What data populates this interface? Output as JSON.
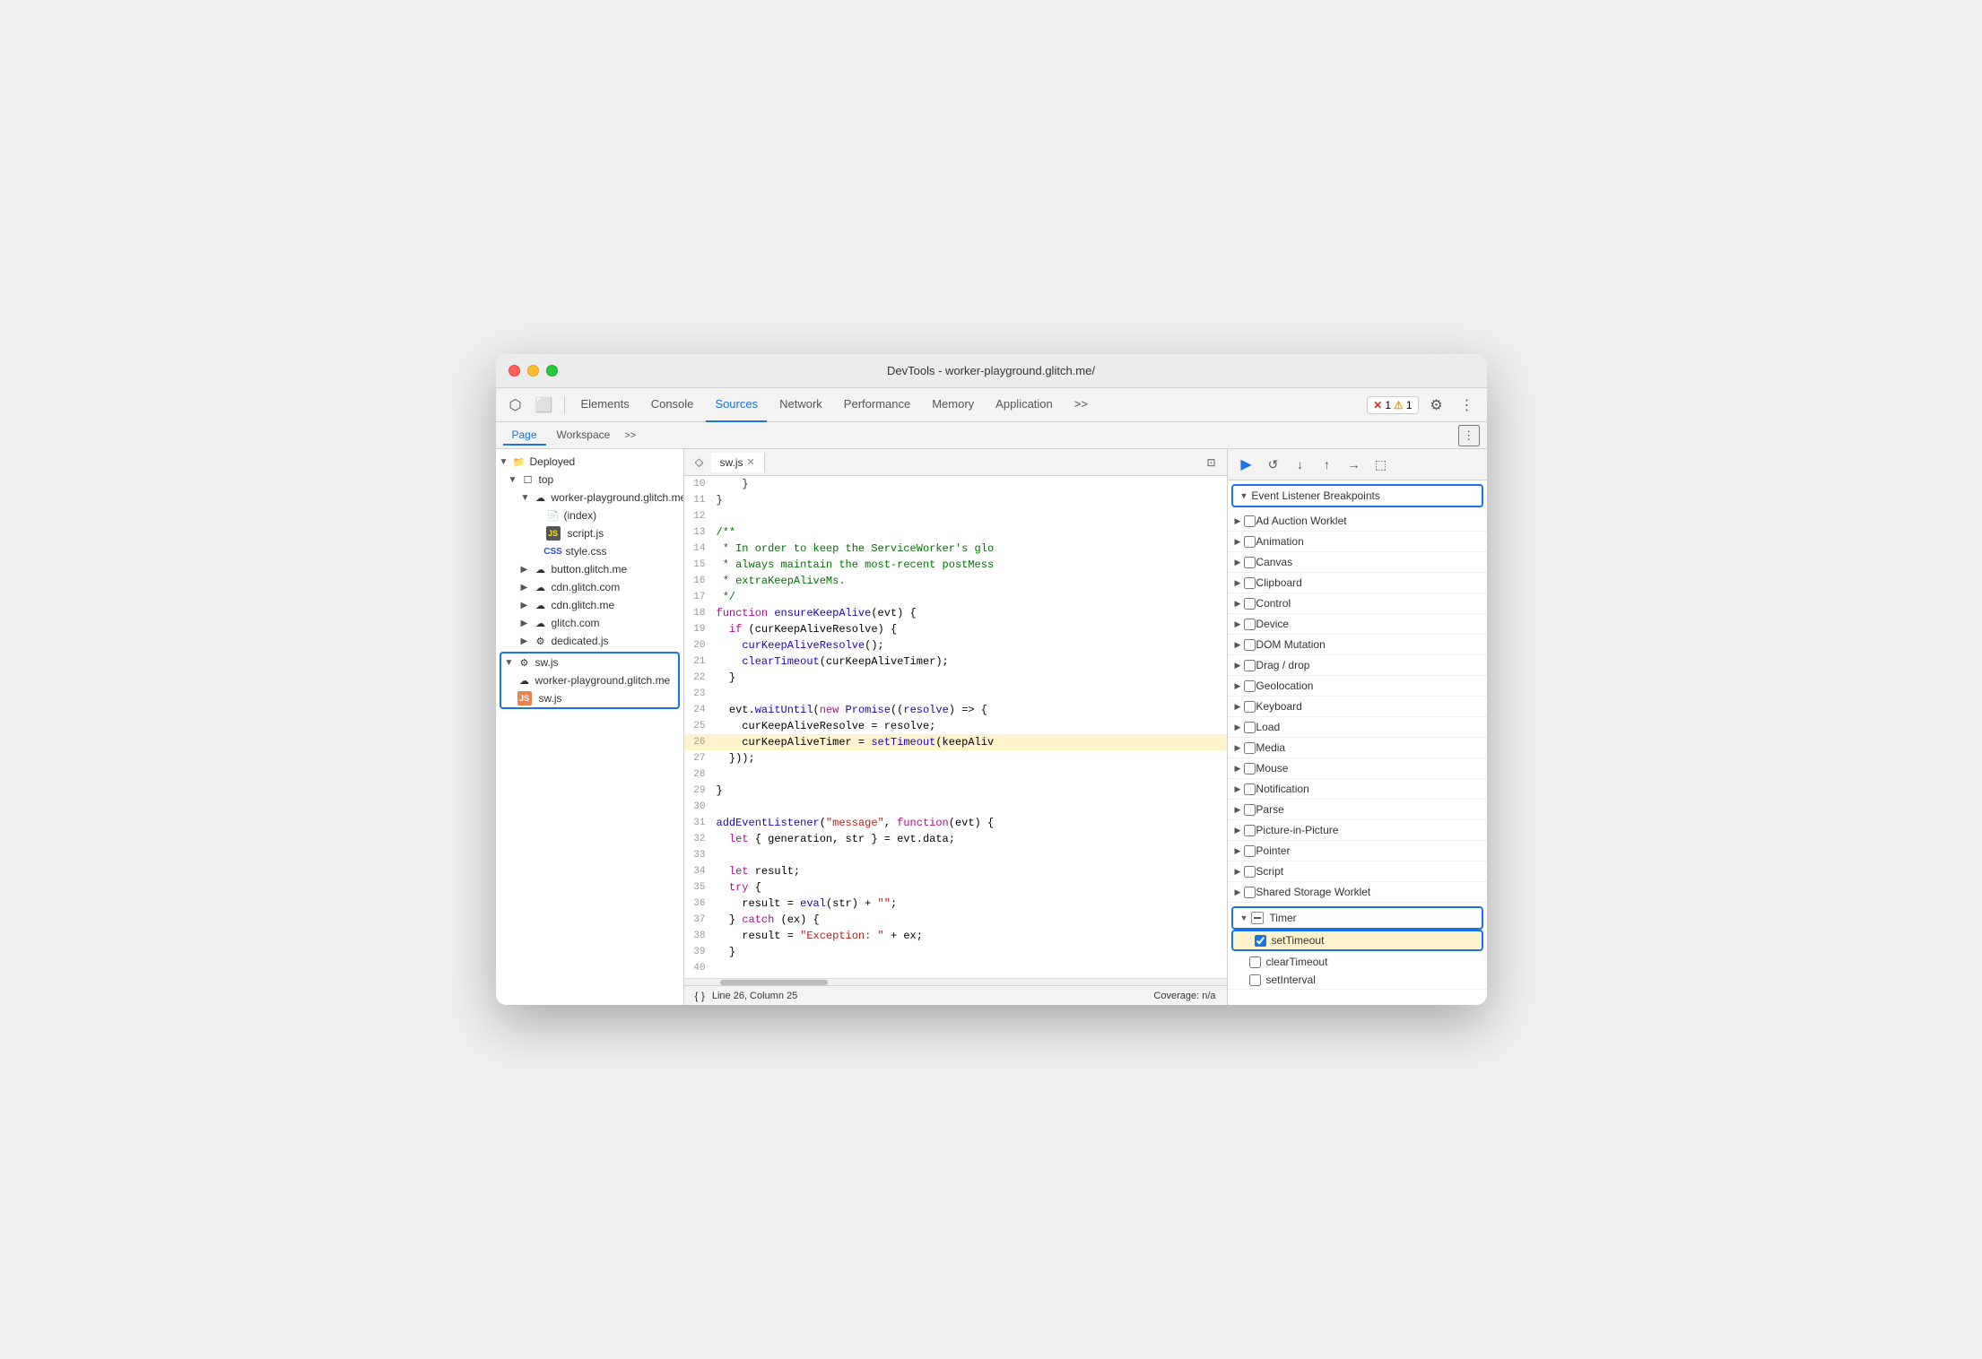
{
  "window": {
    "title": "DevTools - worker-playground.glitch.me/"
  },
  "toolbar": {
    "tabs": [
      "Elements",
      "Console",
      "Sources",
      "Network",
      "Performance",
      "Memory",
      "Application"
    ],
    "active_tab": "Sources",
    "error_count": "1",
    "warning_count": "1"
  },
  "secondary_toolbar": {
    "tabs": [
      "Page",
      "Workspace"
    ],
    "active_tab": "Page"
  },
  "file_tree": {
    "items": [
      {
        "label": "Deployed",
        "indent": 0,
        "type": "folder",
        "open": true
      },
      {
        "label": "top",
        "indent": 1,
        "type": "folder",
        "open": true
      },
      {
        "label": "worker-playground.glitch.me",
        "indent": 2,
        "type": "cloud",
        "open": true
      },
      {
        "label": "(index)",
        "indent": 3,
        "type": "page"
      },
      {
        "label": "script.js",
        "indent": 3,
        "type": "js"
      },
      {
        "label": "style.css",
        "indent": 3,
        "type": "css"
      },
      {
        "label": "button.glitch.me",
        "indent": 2,
        "type": "cloud",
        "open": false
      },
      {
        "label": "cdn.glitch.com",
        "indent": 2,
        "type": "cloud",
        "open": false
      },
      {
        "label": "cdn.glitch.me",
        "indent": 2,
        "type": "cloud",
        "open": false
      },
      {
        "label": "glitch.com",
        "indent": 2,
        "type": "cloud",
        "open": false
      },
      {
        "label": "dedicated.js",
        "indent": 2,
        "type": "gear"
      }
    ],
    "selected_group": {
      "items": [
        {
          "label": "sw.js",
          "indent": 0,
          "type": "gear",
          "open": true
        },
        {
          "label": "worker-playground.glitch.me",
          "indent": 1,
          "type": "cloud"
        },
        {
          "label": "sw.js",
          "indent": 2,
          "type": "js_orange"
        }
      ]
    }
  },
  "code_editor": {
    "tab_name": "sw.js",
    "lines": [
      {
        "num": 10,
        "code": "    }",
        "highlight": false
      },
      {
        "num": 11,
        "code": "}",
        "highlight": false
      },
      {
        "num": 12,
        "code": "",
        "highlight": false
      },
      {
        "num": 13,
        "code": "/**",
        "highlight": false,
        "type": "comment"
      },
      {
        "num": 14,
        "code": " * In order to keep the ServiceWorker's glo",
        "highlight": false,
        "type": "comment"
      },
      {
        "num": 15,
        "code": " * always maintain the most-recent postMess",
        "highlight": false,
        "type": "comment"
      },
      {
        "num": 16,
        "code": " * extraKeepAliveMs.",
        "highlight": false,
        "type": "comment"
      },
      {
        "num": 17,
        "code": " */",
        "highlight": false,
        "type": "comment"
      },
      {
        "num": 18,
        "code": "function ensureKeepAlive(evt) {",
        "highlight": false
      },
      {
        "num": 19,
        "code": "  if (curKeepAliveResolve) {",
        "highlight": false
      },
      {
        "num": 20,
        "code": "    curKeepAliveResolve();",
        "highlight": false
      },
      {
        "num": 21,
        "code": "    clearTimeout(curKeepAliveTimer);",
        "highlight": false
      },
      {
        "num": 22,
        "code": "  }",
        "highlight": false
      },
      {
        "num": 23,
        "code": "",
        "highlight": false
      },
      {
        "num": 24,
        "code": "  evt.waitUntil(new Promise((resolve) => {",
        "highlight": false
      },
      {
        "num": 25,
        "code": "    curKeepAliveResolve = resolve;",
        "highlight": false
      },
      {
        "num": 26,
        "code": "    curKeepAliveTimer = setTimeout(keepAliv",
        "highlight": true
      },
      {
        "num": 27,
        "code": "  }));",
        "highlight": false
      },
      {
        "num": 28,
        "code": "",
        "highlight": false
      },
      {
        "num": 29,
        "code": "}",
        "highlight": false
      },
      {
        "num": 30,
        "code": "",
        "highlight": false
      },
      {
        "num": 31,
        "code": "addEventListener(\"message\", function(evt) {",
        "highlight": false
      },
      {
        "num": 32,
        "code": "  let { generation, str } = evt.data;",
        "highlight": false
      },
      {
        "num": 33,
        "code": "",
        "highlight": false
      },
      {
        "num": 34,
        "code": "  let result;",
        "highlight": false
      },
      {
        "num": 35,
        "code": "  try {",
        "highlight": false
      },
      {
        "num": 36,
        "code": "    result = eval(str) + \"\";",
        "highlight": false
      },
      {
        "num": 37,
        "code": "  } catch (ex) {",
        "highlight": false
      },
      {
        "num": 38,
        "code": "    result = \"Exception: \" + ex;",
        "highlight": false
      },
      {
        "num": 39,
        "code": "  }",
        "highlight": false
      },
      {
        "num": 40,
        "code": "",
        "highlight": false
      }
    ]
  },
  "breakpoints": {
    "section_title": "Event Listener Breakpoints",
    "items": [
      {
        "label": "Ad Auction Worklet",
        "checked": false,
        "open": false
      },
      {
        "label": "Animation",
        "checked": false,
        "open": false
      },
      {
        "label": "Canvas",
        "checked": false,
        "open": false
      },
      {
        "label": "Clipboard",
        "checked": false,
        "open": false
      },
      {
        "label": "Control",
        "checked": false,
        "open": false
      },
      {
        "label": "Device",
        "checked": false,
        "open": false
      },
      {
        "label": "DOM Mutation",
        "checked": false,
        "open": false
      },
      {
        "label": "Drag / drop",
        "checked": false,
        "open": false
      },
      {
        "label": "Geolocation",
        "checked": false,
        "open": false
      },
      {
        "label": "Keyboard",
        "checked": false,
        "open": false
      },
      {
        "label": "Load",
        "checked": false,
        "open": false
      },
      {
        "label": "Media",
        "checked": false,
        "open": false
      },
      {
        "label": "Mouse",
        "checked": false,
        "open": false
      },
      {
        "label": "Notification",
        "checked": false,
        "open": false
      },
      {
        "label": "Parse",
        "checked": false,
        "open": false
      },
      {
        "label": "Picture-in-Picture",
        "checked": false,
        "open": false
      },
      {
        "label": "Pointer",
        "checked": false,
        "open": false
      },
      {
        "label": "Script",
        "checked": false,
        "open": false
      },
      {
        "label": "Shared Storage Worklet",
        "checked": false,
        "open": false
      }
    ],
    "timer_section": {
      "label": "Timer",
      "open": true,
      "highlighted": true,
      "sub_items": [
        {
          "label": "setTimeout",
          "checked": true,
          "highlighted": true
        },
        {
          "label": "clearTimeout",
          "checked": false
        },
        {
          "label": "setInterval",
          "checked": false
        }
      ]
    }
  },
  "status_bar": {
    "format_btn": "{ }",
    "position": "Line 26, Column 25",
    "coverage": "Coverage: n/a"
  }
}
